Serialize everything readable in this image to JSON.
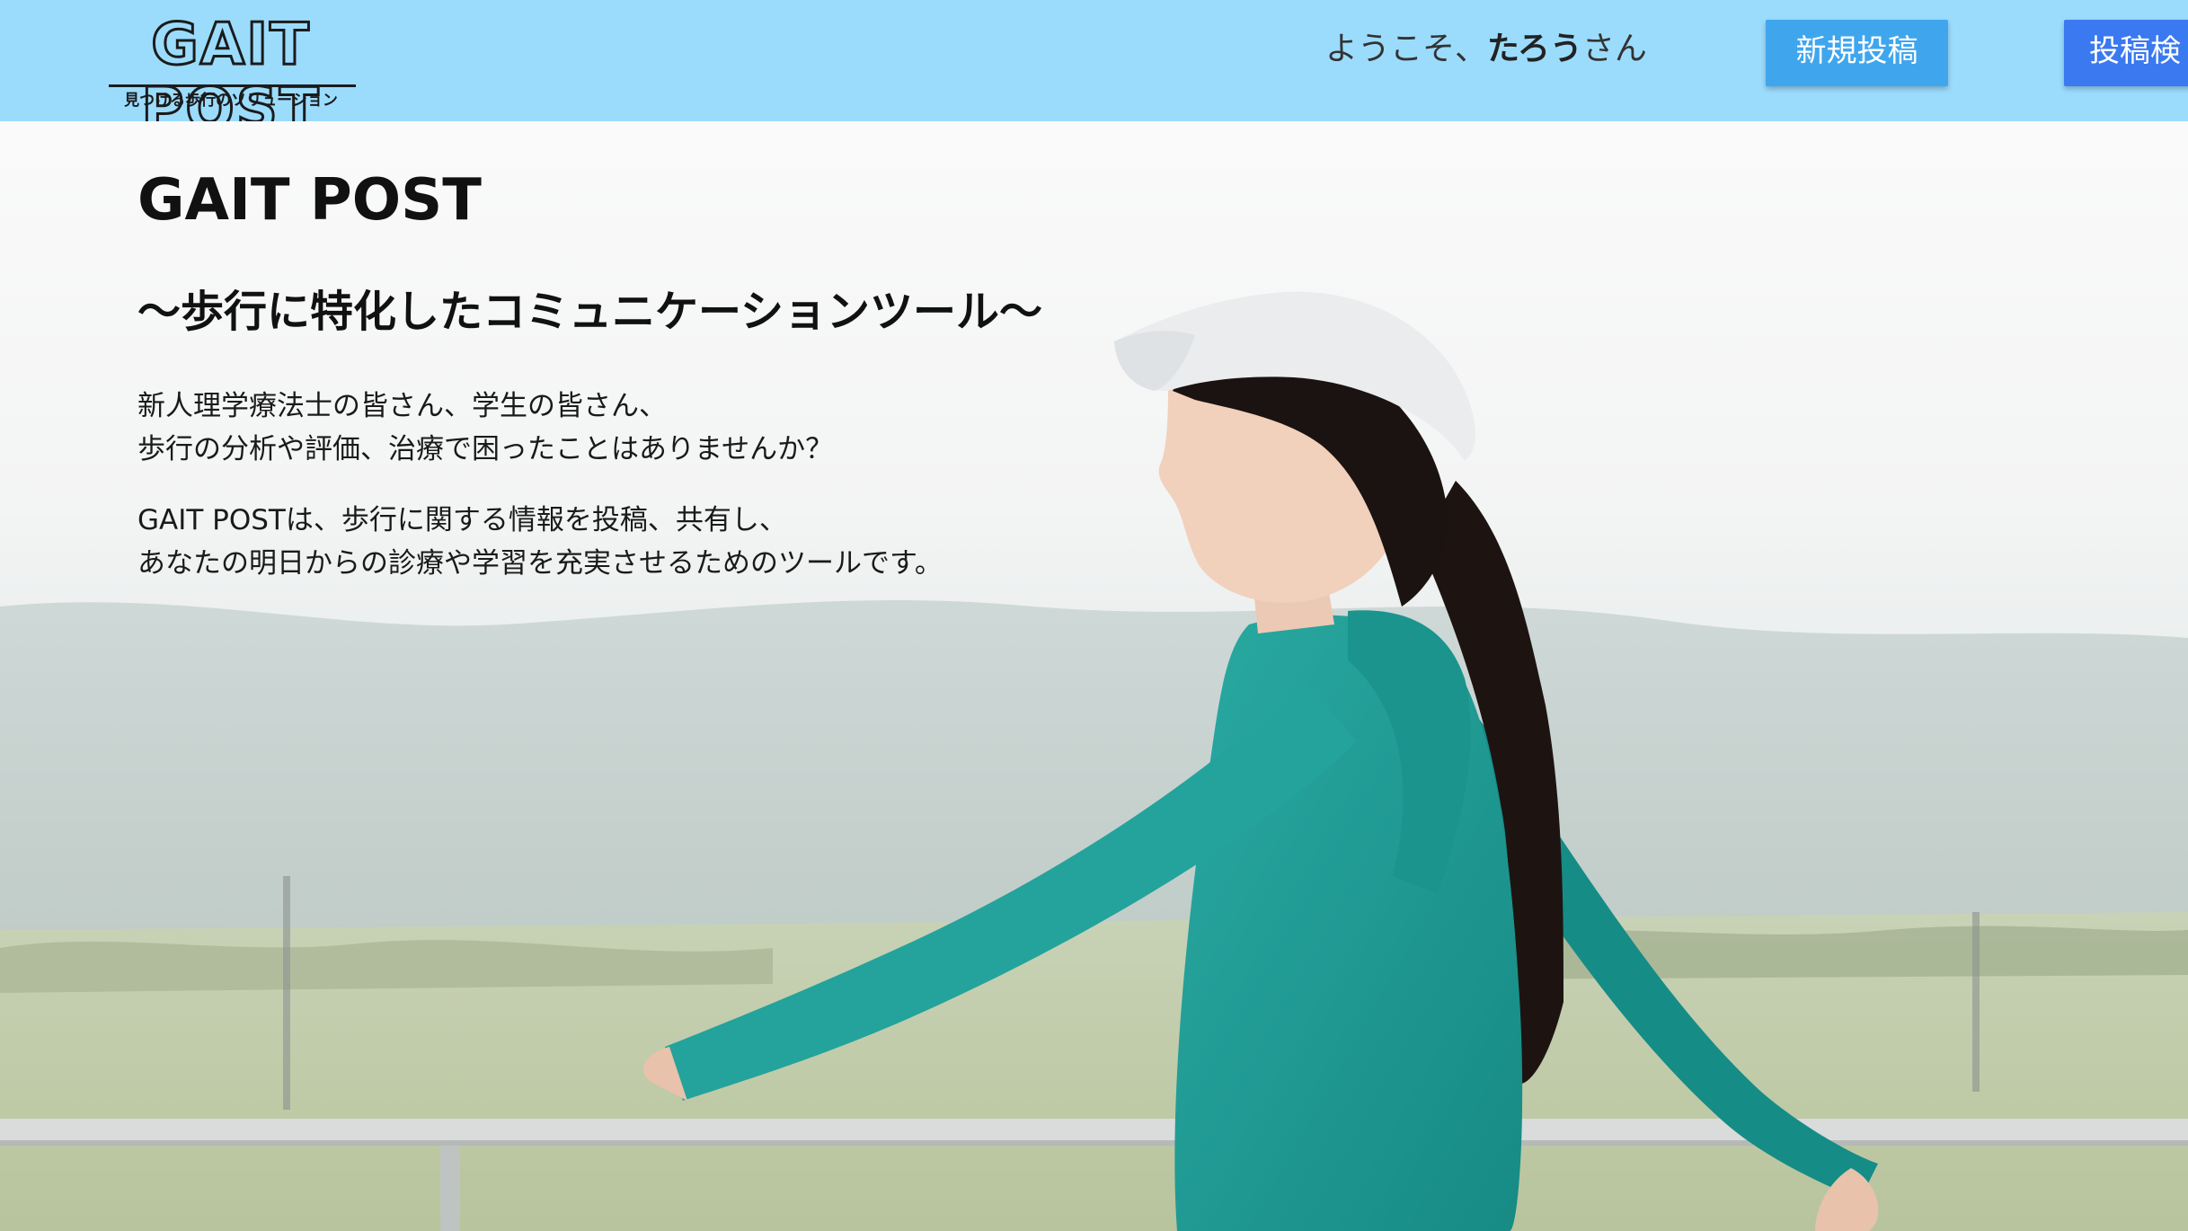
{
  "header": {
    "logo_title": "GAIT POST",
    "logo_tagline": "見つける歩行のソリューション",
    "welcome_prefix": "ようこそ、",
    "user_name": "たろう",
    "welcome_suffix": "さん",
    "new_post_button": "新規投稿",
    "search_button": "投稿検"
  },
  "hero": {
    "title": "GAIT POST",
    "subtitle": "〜歩行に特化したコミュニケーションツール〜",
    "paragraph1_line1": "新人理学療法士の皆さん、学生の皆さん、",
    "paragraph1_line2": "歩行の分析や評価、治療で困ったことはありませんか？",
    "paragraph2_line1": "GAIT POSTは、歩行に関する情報を投稿、共有し、",
    "paragraph2_line2": "あなたの明日からの診療や学習を充実させるためのツールです。"
  },
  "colors": {
    "header_bg": "#9bdcfd",
    "new_post_button": "#3fa6ee",
    "search_button": "#3b79f0",
    "jacket": "#1f9a93"
  }
}
